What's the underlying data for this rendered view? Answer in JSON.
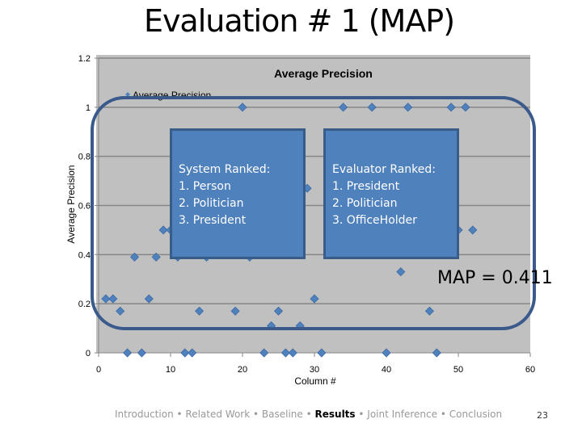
{
  "slide": {
    "title": "Evaluation # 1 (MAP)",
    "system_box": {
      "heading": "System Ranked:",
      "items": [
        "1. Person",
        "2. Politician",
        "3. President"
      ]
    },
    "evaluator_box": {
      "heading": "Evaluator Ranked:",
      "items": [
        "1. President",
        "2. Politician",
        "3. OfficeHolder"
      ]
    },
    "map_label": "MAP = 0.411",
    "footer": {
      "items": [
        "Introduction",
        "Related Work",
        "Baseline",
        "Results",
        "Joint Inference",
        "Conclusion"
      ],
      "active": "Results",
      "separator": "•"
    },
    "page_number": "23"
  },
  "colors": {
    "marker": "#4f81bd",
    "plot_bg": "#c0c0c0",
    "box_fill": "#4f81bd",
    "outline": "#3a5a8c"
  },
  "chart_data": {
    "type": "scatter",
    "title": "Average Precision",
    "xlabel": "Column #",
    "ylabel": "Average Precision",
    "legend": {
      "entries": [
        "Average Precision"
      ],
      "placement": "top-left"
    },
    "xlim": [
      0,
      60
    ],
    "ylim": [
      0,
      1.2
    ],
    "xticks": [
      0,
      10,
      20,
      30,
      40,
      50,
      60
    ],
    "yticks": [
      0,
      0.2,
      0.4,
      0.6,
      0.8,
      1,
      1.2
    ],
    "grid": true,
    "series": [
      {
        "name": "Average Precision",
        "x": [
          1,
          2,
          3,
          4,
          5,
          6,
          7,
          8,
          9,
          10,
          11,
          12,
          13,
          14,
          15,
          19,
          20,
          21,
          23,
          24,
          25,
          26,
          27,
          28,
          29,
          30,
          31,
          34,
          38,
          40,
          42,
          43,
          46,
          47,
          49,
          50,
          51,
          52
        ],
        "y": [
          0.22,
          0.22,
          0.17,
          0,
          0.39,
          0,
          0.22,
          0.39,
          0.5,
          0.5,
          0.39,
          0,
          0,
          0.17,
          0.39,
          0.17,
          1,
          0.39,
          0,
          0.11,
          0.17,
          0,
          0,
          0.11,
          0.67,
          0.22,
          0,
          1,
          1,
          0,
          0.33,
          1,
          0.17,
          0,
          1,
          0.5,
          1,
          0.5
        ]
      }
    ]
  }
}
